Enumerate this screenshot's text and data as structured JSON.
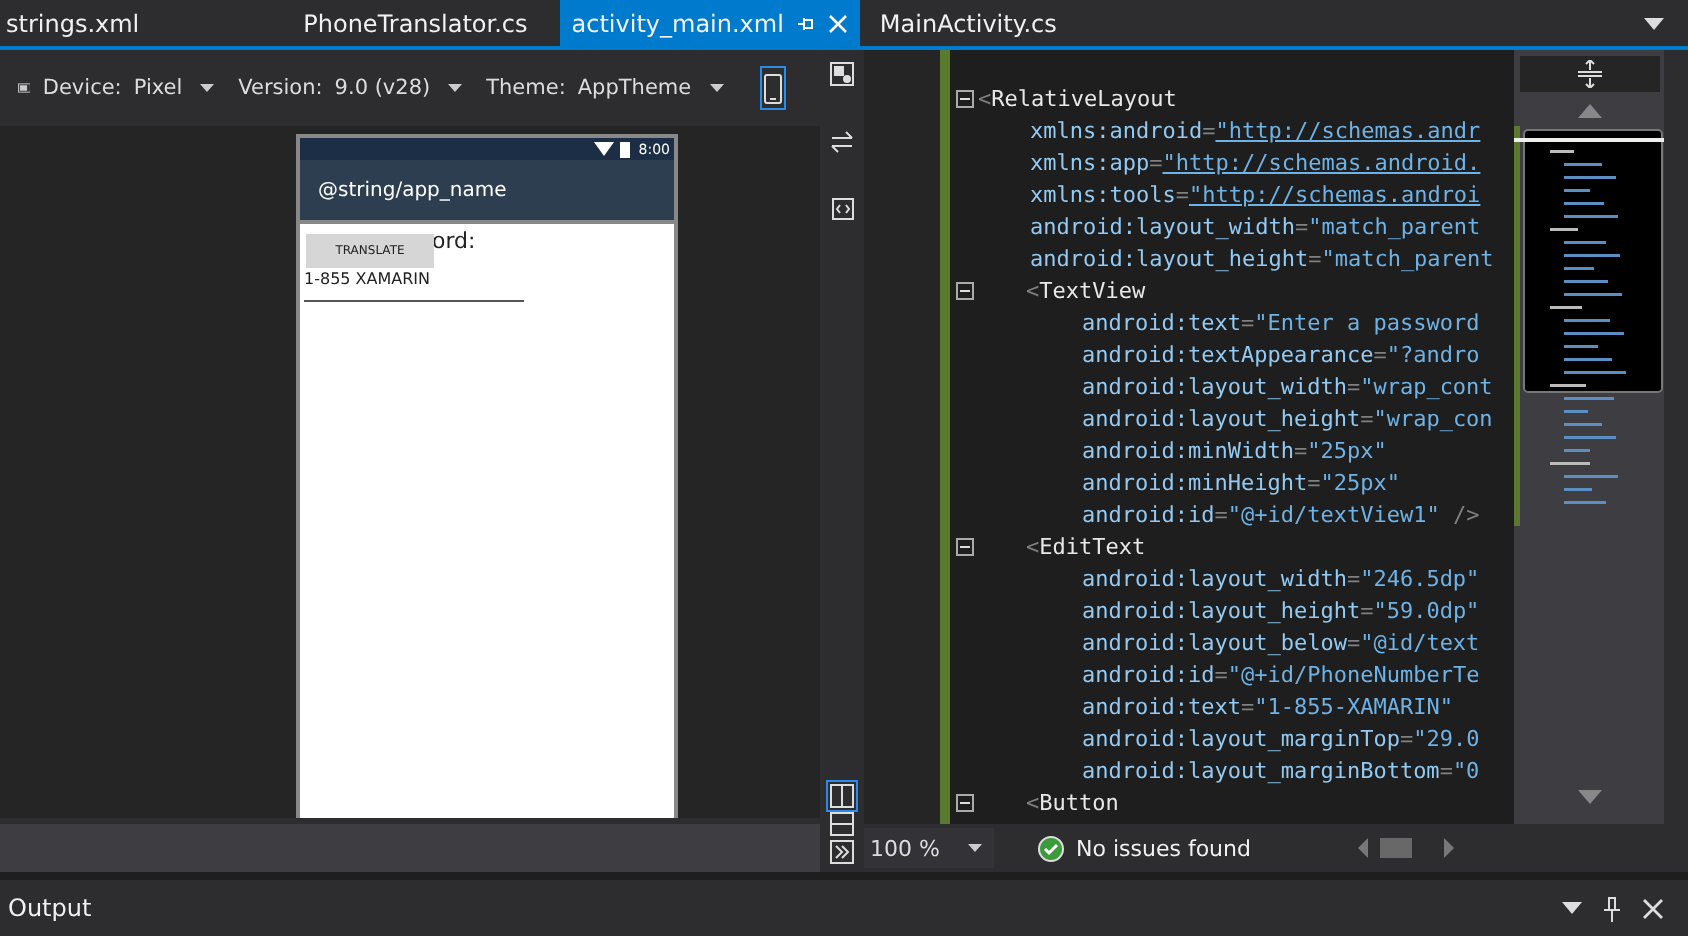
{
  "tabs": [
    {
      "label": "strings.xml",
      "selected": false
    },
    {
      "label": "PhoneTranslator.cs",
      "selected": false
    },
    {
      "label": "activity_main.xml",
      "selected": true
    },
    {
      "label": "MainActivity.cs",
      "selected": false
    }
  ],
  "designer_toolbar": {
    "fields": [
      {
        "label": "Device:",
        "value": "Pixel"
      },
      {
        "label": "Version:",
        "value": "9.0 (v28)"
      },
      {
        "label": "Theme:",
        "value": "AppTheme"
      }
    ],
    "phone_view_selected": true
  },
  "phone": {
    "clock": "8:00",
    "app_title": "@string/app_name",
    "text_view": "ord:",
    "button": "TRANSLATE",
    "edit_text": "1-855 XAMARIN"
  },
  "code": [
    {
      "bracket": "<",
      "tag": "RelativeLayout",
      "expanded": true,
      "attributes": [
        {
          "name": "xmlns:android",
          "eq": "=",
          "value": "\"http://schemas.andr",
          "link": true
        },
        {
          "name": "xmlns:app",
          "eq": "=",
          "value": "\"http://schemas.android.",
          "link": true
        },
        {
          "name": "xmlns:tools",
          "eq": "=",
          "value": "\"http://schemas.androi",
          "link": true
        },
        {
          "name": "android:layout_width",
          "eq": "=",
          "value": "\"match_parent",
          "link": false
        },
        {
          "name": "android:layout_height",
          "eq": "=",
          "value": "\"match_parent",
          "link": false
        }
      ],
      "children": [
        {
          "bracket": "<",
          "tag": "TextView",
          "expanded": true,
          "attributes": [
            {
              "name": "android:text",
              "eq": "=",
              "value": "\"Enter a password",
              "link": false
            },
            {
              "name": "android:textAppearance",
              "eq": "=",
              "value": "\"?andro",
              "link": false
            },
            {
              "name": "android:layout_width",
              "eq": "=",
              "value": "\"wrap_cont",
              "link": false
            },
            {
              "name": "android:layout_height",
              "eq": "=",
              "value": "\"wrap_con",
              "link": false
            },
            {
              "name": "android:minWidth",
              "eq": "=",
              "value": "\"25px\"",
              "link": false
            },
            {
              "name": "android:minHeight",
              "eq": "=",
              "value": "\"25px\"",
              "link": false
            },
            {
              "name": "android:id",
              "eq": "=",
              "value": "\"@+id/textView1\"",
              "suffix": " />",
              "link": false
            }
          ]
        },
        {
          "bracket": "<",
          "tag": "EditText",
          "expanded": true,
          "attributes": [
            {
              "name": "android:layout_width",
              "eq": "=",
              "value": "\"246.5dp\"",
              "link": false
            },
            {
              "name": "android:layout_height",
              "eq": "=",
              "value": "\"59.0dp\"",
              "link": false
            },
            {
              "name": "android:layout_below",
              "eq": "=",
              "value": "\"@id/text",
              "link": false
            },
            {
              "name": "android:id",
              "eq": "=",
              "value": "\"@+id/PhoneNumberTe",
              "link": false
            },
            {
              "name": "android:text",
              "eq": "=",
              "value": "\"1-855-XAMARIN\"",
              "link": false
            },
            {
              "name": "android:layout_marginTop",
              "eq": "=",
              "value": "\"29.0",
              "link": false
            },
            {
              "name": "android:layout_marginBottom",
              "eq": "=",
              "value": "\"0",
              "link": false
            }
          ]
        },
        {
          "bracket": "<",
          "tag": "Button",
          "expanded": true
        }
      ]
    }
  ],
  "status_bar": {
    "zoom": "100 %",
    "issues": "No issues found"
  },
  "output_panel": {
    "title": "Output"
  }
}
